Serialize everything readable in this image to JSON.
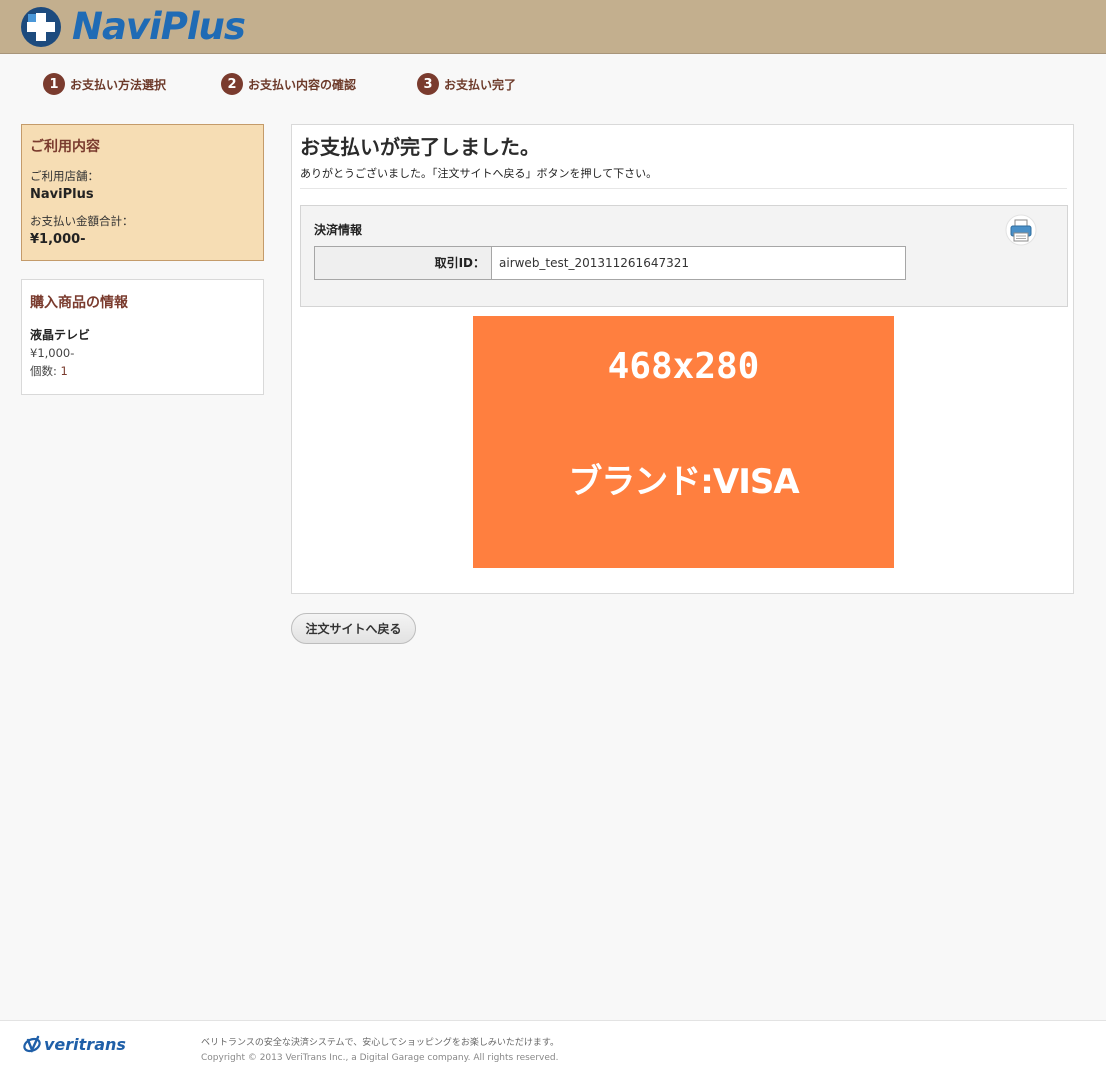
{
  "header": {
    "brand": "NaviPlus",
    "logo_icon": "medical-cross-icon",
    "bar_color": "#c3af8e"
  },
  "steps": [
    {
      "num": "1",
      "label": "お支払い方法選択"
    },
    {
      "num": "2",
      "label": "お支払い内容の確認"
    },
    {
      "num": "3",
      "label": "お支払い完了"
    }
  ],
  "usage": {
    "title": "ご利用内容",
    "store_label": "ご利用店舗：",
    "store_name": "NaviPlus",
    "total_label": "お支払い金額合計：",
    "total_value": "¥1,000-"
  },
  "items": {
    "title": "購入商品の情報",
    "product_name": "液晶テレビ",
    "product_price": "¥1,000-",
    "quantity_label": "個数:",
    "quantity_value": "1"
  },
  "main": {
    "title": "お支払いが完了しました。",
    "message": "ありがとうございました。「注文サイトへ戻る」ボタンを押して下さい。",
    "payinfo_title": "決済情報",
    "print_icon": "printer-icon",
    "txn_label": "取引ID：",
    "txn_value": "airweb_test_201311261647321",
    "banner_size": "468x280",
    "banner_brand": "ブランド:VISA",
    "banner_color": "#ff7f3f"
  },
  "back_button": "注文サイトへ戻る",
  "footer": {
    "brand": "veritrans",
    "line1": "ベリトランスの安全な決済システムで、安心してショッピングをお楽しみいただけます。",
    "line2": "Copyright © 2013 VeriTrans Inc., a Digital Garage company. All rights reserved."
  }
}
